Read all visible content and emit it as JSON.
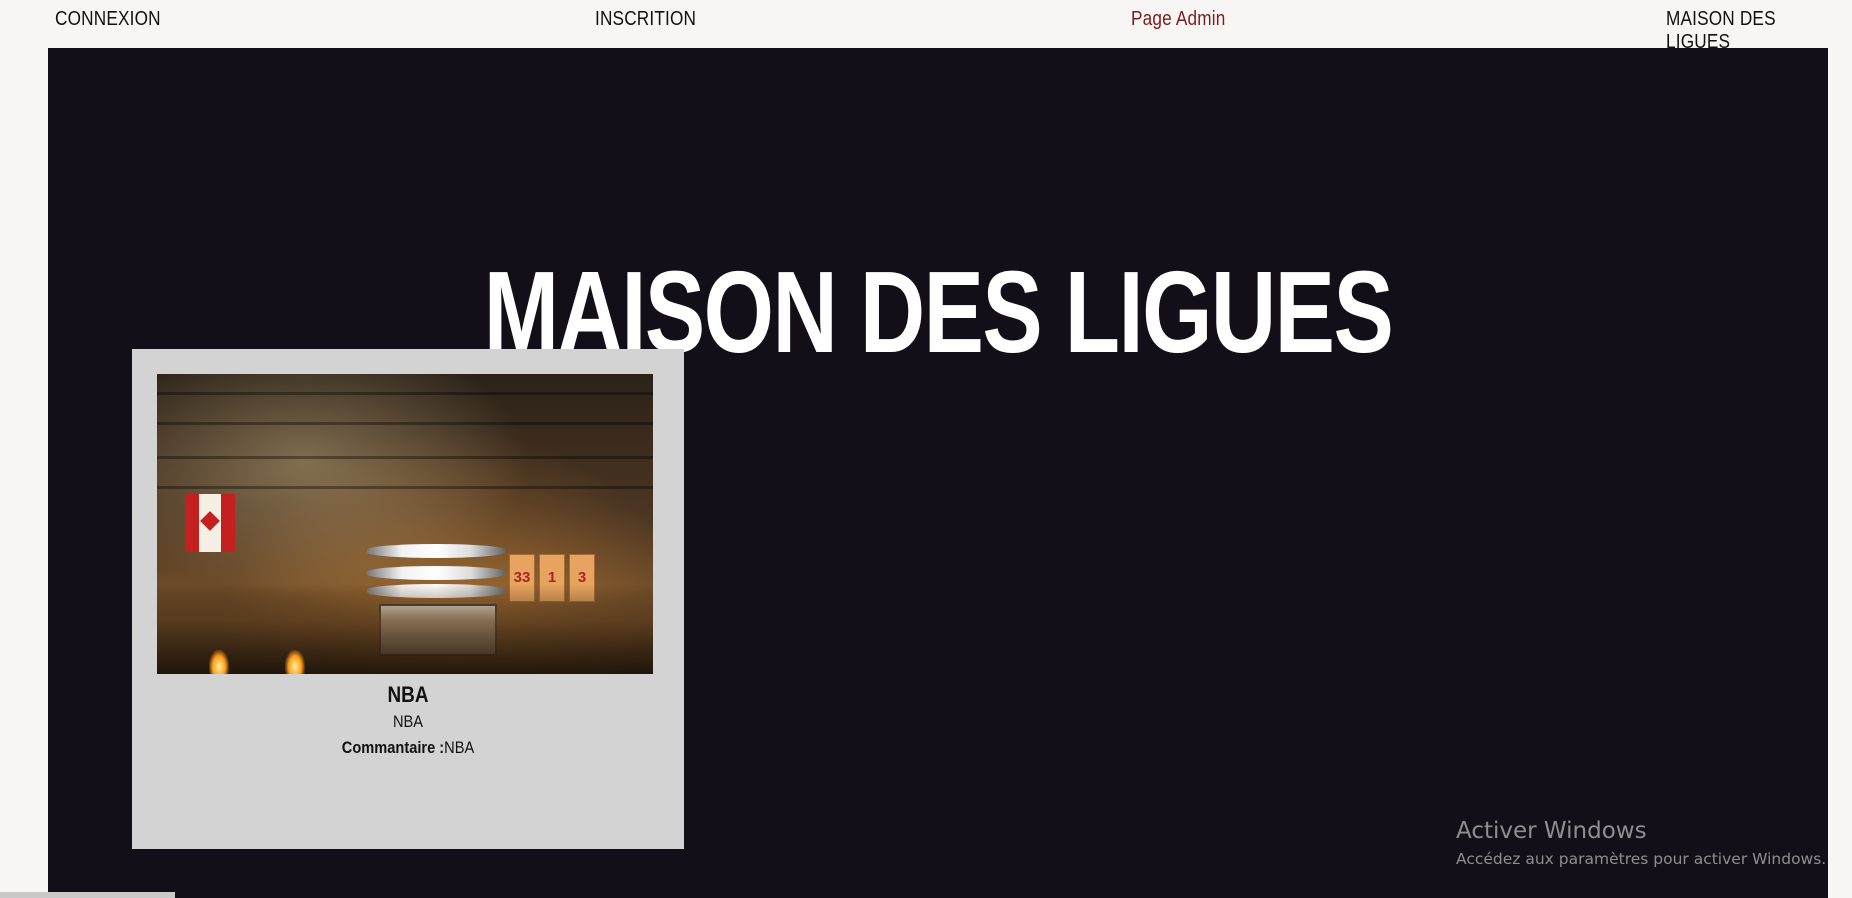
{
  "nav": {
    "connexion": "CONNEXION",
    "inscription": "INSCRITION",
    "admin": "Page Admin",
    "brand": "MAISON DES LIGUES"
  },
  "hero": {
    "title": "MAISON DES LIGUES"
  },
  "cards": [
    {
      "title": "NBA",
      "subtitle": "NBA",
      "comment_label": "Commantaire :",
      "comment_value": "NBA",
      "image_alt": "basketball arena with jumbotron and Canadian flag"
    }
  ],
  "image_jerseys": [
    "33",
    "1",
    "3"
  ],
  "watermark": {
    "title": "Activer Windows",
    "subtitle": "Accédez aux paramètres pour activer Windows."
  },
  "colors": {
    "main_bg": "#130f18",
    "card_bg": "#d3d3d3",
    "admin_link": "#7b1d1d"
  }
}
